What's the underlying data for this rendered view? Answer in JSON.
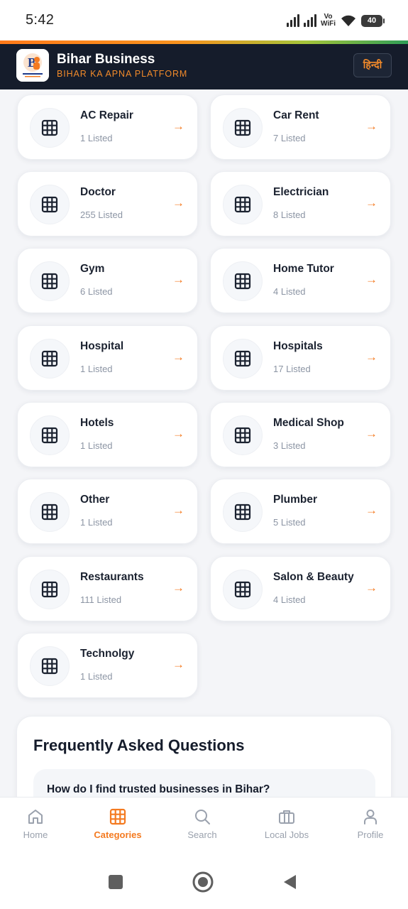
{
  "status_bar": {
    "time": "5:42",
    "network_label_1": "Vo",
    "network_label_2": "WiFi",
    "battery": "40"
  },
  "header": {
    "title": "Bihar Business",
    "tagline": "BIHAR KA APNA PLATFORM",
    "language_button": "हिन्दी"
  },
  "categories": [
    {
      "name": "AC Repair",
      "count": "1 Listed"
    },
    {
      "name": "Car Rent",
      "count": "7 Listed"
    },
    {
      "name": "Doctor",
      "count": "255 Listed"
    },
    {
      "name": "Electrician",
      "count": "8 Listed"
    },
    {
      "name": "Gym",
      "count": "6 Listed"
    },
    {
      "name": "Home Tutor",
      "count": "4 Listed"
    },
    {
      "name": "Hospital",
      "count": "1 Listed"
    },
    {
      "name": "Hospitals",
      "count": "17 Listed"
    },
    {
      "name": "Hotels",
      "count": "1 Listed"
    },
    {
      "name": "Medical Shop",
      "count": "3 Listed"
    },
    {
      "name": "Other",
      "count": "1 Listed"
    },
    {
      "name": "Plumber",
      "count": "5 Listed"
    },
    {
      "name": "Restaurants",
      "count": "111 Listed"
    },
    {
      "name": "Salon & Beauty",
      "count": "4 Listed"
    },
    {
      "name": "Technolgy",
      "count": "1 Listed"
    }
  ],
  "arrow_glyph": "→",
  "faq": {
    "title": "Frequently Asked Questions",
    "items": [
      {
        "question": "How do I find trusted businesses in Bihar?"
      }
    ]
  },
  "bottom_nav": {
    "items": [
      {
        "label": "Home",
        "icon": "home-icon"
      },
      {
        "label": "Categories",
        "icon": "grid-icon",
        "active": true
      },
      {
        "label": "Search",
        "icon": "search-icon"
      },
      {
        "label": "Local Jobs",
        "icon": "briefcase-icon"
      },
      {
        "label": "Profile",
        "icon": "user-icon"
      }
    ]
  },
  "colors": {
    "accent": "#f47a20",
    "header_bg": "#151c2b",
    "page_bg": "#f4f5f8",
    "muted_text": "#8c95a4"
  }
}
